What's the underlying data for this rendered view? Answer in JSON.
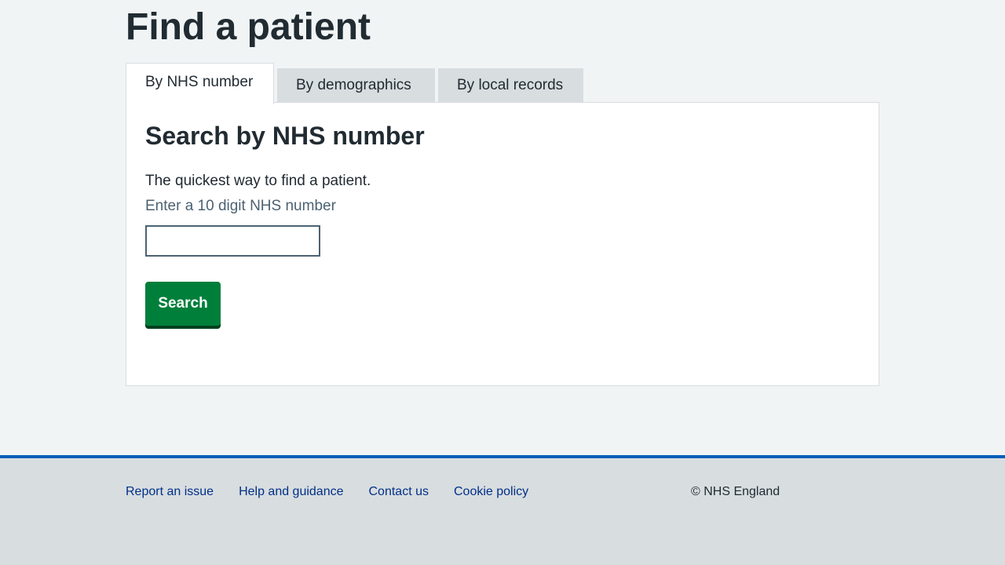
{
  "page": {
    "title": "Find a patient"
  },
  "tabs": [
    {
      "label": "By NHS number",
      "active": true
    },
    {
      "label": "By demographics",
      "active": false
    },
    {
      "label": "By local records",
      "active": false
    }
  ],
  "panel": {
    "heading": "Search by NHS number",
    "intro": "The quickest way to find a patient.",
    "input_label": "Enter a 10 digit NHS number",
    "input_value": "",
    "search_label": "Search"
  },
  "footer": {
    "links": [
      {
        "label": "Report an issue"
      },
      {
        "label": "Help and guidance"
      },
      {
        "label": "Contact us"
      },
      {
        "label": "Cookie policy"
      }
    ],
    "copyright": "© NHS England"
  },
  "colors": {
    "page_background": "#f0f4f5",
    "text": "#212b32",
    "secondary_text": "#4c6272",
    "button_green": "#007f3b",
    "button_shadow": "#00401e",
    "footer_border_blue": "#005eb8",
    "link_blue": "#003087",
    "tab_inactive": "#d8dde0"
  }
}
